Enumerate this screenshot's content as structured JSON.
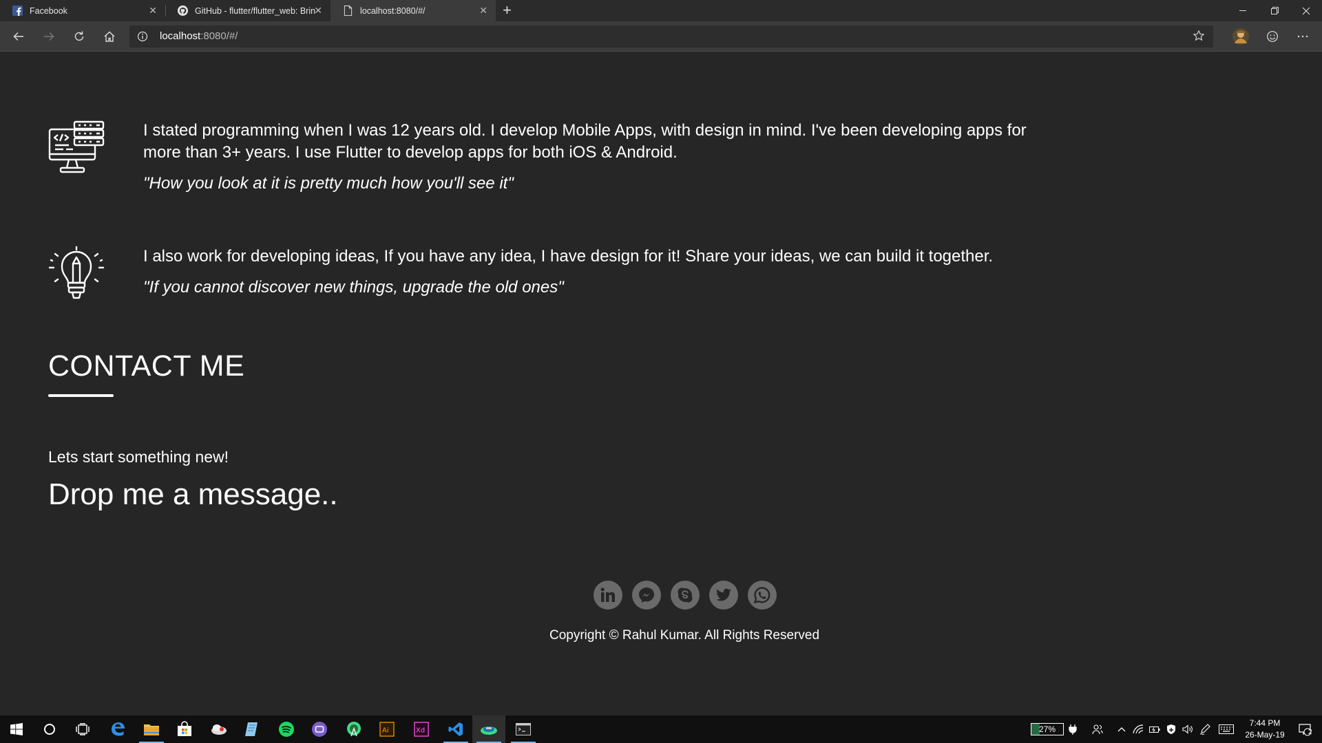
{
  "browser": {
    "tabs": [
      {
        "label": "Facebook",
        "icon": "facebook-icon"
      },
      {
        "label": "GitHub - flutter/flutter_web: Brin",
        "icon": "github-icon"
      },
      {
        "label": "localhost:8080/#/",
        "icon": "page-icon"
      }
    ],
    "address": {
      "host": "localhost",
      "rest": ":8080/#/"
    },
    "window_controls": [
      "minimize",
      "restore",
      "close"
    ]
  },
  "page": {
    "services": [
      {
        "icon": "developer-computer-icon",
        "description": "I stated programming when I was 12 years old. I develop Mobile Apps, with design in mind. I've been developing apps for more than 3+ years. I use Flutter to develop apps for both iOS & Android.",
        "quote": "\"How you look at it is pretty much how you'll see it\""
      },
      {
        "icon": "lightbulb-pencil-icon",
        "description": "I also work for developing ideas, If you have any idea, I have design for it! Share your ideas, we can build it together.",
        "quote": "\"If you cannot discover new things, upgrade the old ones\""
      }
    ],
    "contact": {
      "title": "CONTACT ME",
      "tagline": "Lets start something new!",
      "cta": "Drop me a message.."
    },
    "socials": [
      "linkedin-icon",
      "messenger-icon",
      "skype-icon",
      "twitter-icon",
      "whatsapp-icon"
    ],
    "copyright": "Copyright © Rahul Kumar. All Rights Reserved"
  },
  "taskbar": {
    "battery": "27%",
    "time": "7:44 PM",
    "date": "26-May-19",
    "notifications": "2"
  }
}
